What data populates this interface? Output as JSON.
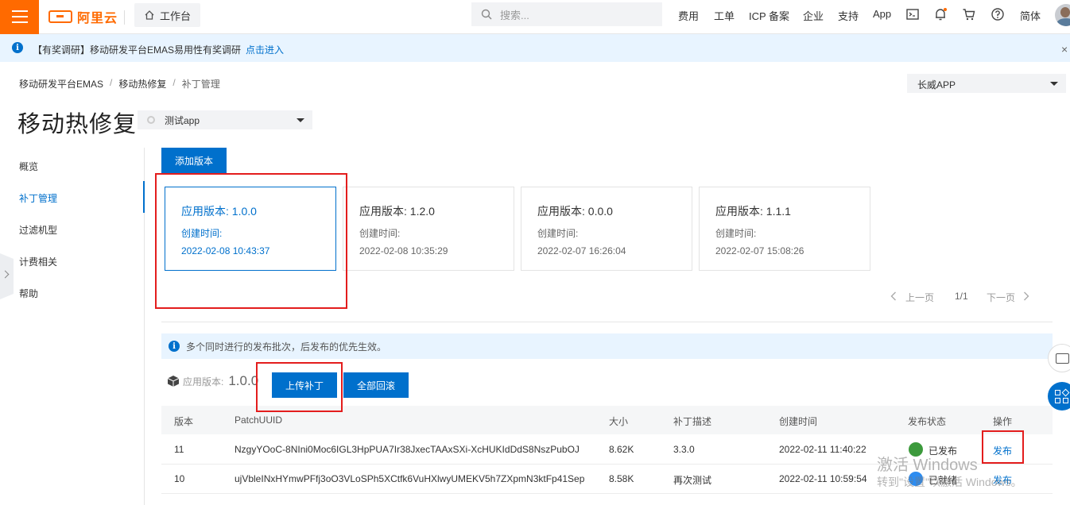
{
  "topbar": {
    "brand": "阿里云",
    "workbench": "工作台",
    "search_placeholder": "搜索...",
    "nav": [
      "费用",
      "工单",
      "ICP 备案",
      "企业",
      "支持",
      "App"
    ],
    "lang": "简体"
  },
  "notice": {
    "message": "【有奖调研】移动研发平台EMAS易用性有奖调研",
    "link": "点击进入",
    "close": "×"
  },
  "breadcrumb": [
    "移动研发平台EMAS",
    "移动热修复",
    "补丁管理"
  ],
  "region": "长威APP",
  "page": {
    "title": "移动热修复",
    "app_selected": "测试app"
  },
  "sidebar": {
    "items": [
      "概览",
      "补丁管理",
      "过滤机型",
      "计费相关",
      "帮助"
    ]
  },
  "toolbar": {
    "add_version": "添加版本"
  },
  "versions": [
    {
      "version": "应用版本: 1.0.0",
      "created_label": "创建时间:",
      "created": "2022-02-08 10:43:37"
    },
    {
      "version": "应用版本: 1.2.0",
      "created_label": "创建时间:",
      "created": "2022-02-08 10:35:29"
    },
    {
      "version": "应用版本: 0.0.0",
      "created_label": "创建时间:",
      "created": "2022-02-07 16:26:04"
    },
    {
      "version": "应用版本: 1.1.1",
      "created_label": "创建时间:",
      "created": "2022-02-07 15:08:26"
    }
  ],
  "pager": {
    "prev": "上一页",
    "page": "1/1",
    "next": "下一页"
  },
  "tip": "多个同时进行的发布批次，后发布的优先生效。",
  "app_version": {
    "label": "应用版本:",
    "value": "1.0.0"
  },
  "actions": {
    "upload": "上传补丁",
    "rollback": "全部回滚"
  },
  "table": {
    "headers": [
      "版本",
      "PatchUUID",
      "大小",
      "补丁描述",
      "创建时间",
      "发布状态",
      "操作"
    ],
    "rows": [
      {
        "version": "11",
        "uuid": "NzgyYOoC-8NIni0Moc6IGL3HpPUA7Ir38JxecTAAxSXi-XcHUKIdDdS8NszPubOJ",
        "size": "8.62K",
        "desc": "3.3.0",
        "created": "2022-02-11 11:40:22",
        "status": "已发布",
        "status_color": "#3c9a3c",
        "op": "发布"
      },
      {
        "version": "10",
        "uuid": "ujVbleINxHYmwPFfj3oO3VLoSPh5XCtfk6VuHXlwyUMEKV5h7ZXpmN3ktFp41Sep",
        "size": "8.58K",
        "desc": "再次测试",
        "created": "2022-02-11 10:59:54",
        "status": "已就绪",
        "status_color": "#2d8cf0",
        "op": "发布"
      }
    ]
  },
  "watermark": {
    "line1": "激活 Windows",
    "line2": "转到\"设置\"以激活 Windows。"
  },
  "colors": {
    "accent": "#0070cc",
    "brand": "#ff6a00",
    "highlight": "#e31d1d"
  }
}
